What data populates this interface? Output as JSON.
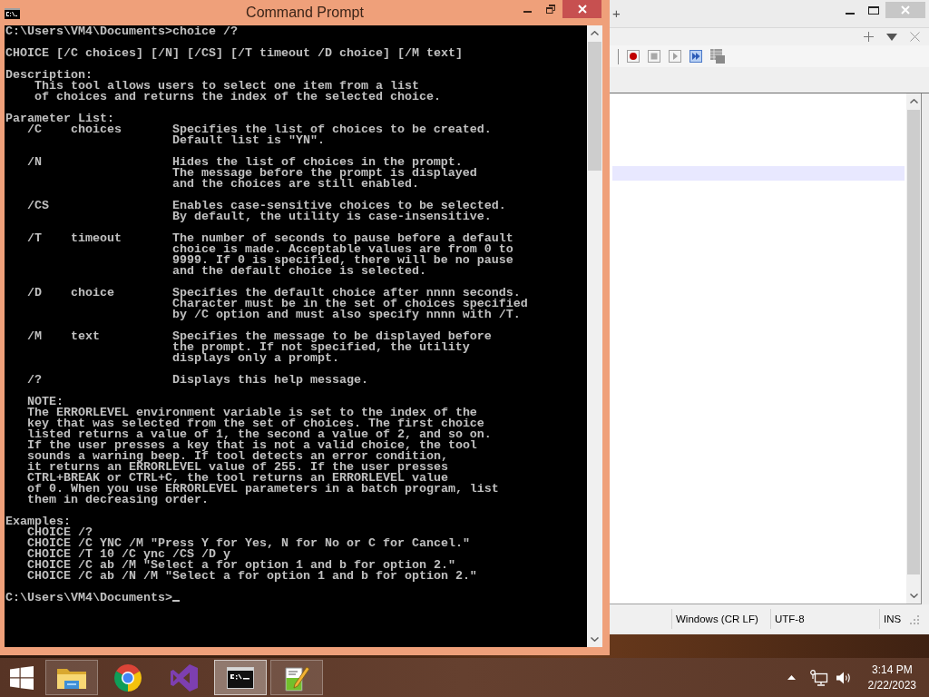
{
  "cmd_window": {
    "title": "Command Prompt",
    "console": {
      "command_line": "C:\\Users\\VM4\\Documents>choice /?",
      "usage": "CHOICE [/C choices] [/N] [/CS] [/T timeout /D choice] [/M text]",
      "description": {
        "heading": "Description:",
        "lines": [
          "This tool allows users to select one item from a list",
          "of choices and returns the index of the selected choice."
        ]
      },
      "parameter_list": {
        "heading": "Parameter List:",
        "parameters": [
          {
            "option": "/C",
            "argument": "choices",
            "lines": [
              "Specifies the list of choices to be created.",
              "Default list is \"YN\"."
            ]
          },
          {
            "option": "/N",
            "lines": [
              "Hides the list of choices in the prompt.",
              "The message before the prompt is displayed",
              "and the choices are still enabled."
            ]
          },
          {
            "option": "/CS",
            "lines": [
              "Enables case-sensitive choices to be selected.",
              "By default, the utility is case-insensitive."
            ]
          },
          {
            "option": "/T",
            "argument": "timeout",
            "lines": [
              "The number of seconds to pause before a default",
              "choice is made. Acceptable values are from 0 to",
              "9999. If 0 is specified, there will be no pause",
              "and the default choice is selected."
            ]
          },
          {
            "option": "/D",
            "argument": "choice",
            "lines": [
              "Specifies the default choice after nnnn seconds.",
              "Character must be in the set of choices specified",
              "by /C option and must also specify nnnn with /T."
            ]
          },
          {
            "option": "/M",
            "argument": "text",
            "lines": [
              "Specifies the message to be displayed before",
              "the prompt. If not specified, the utility",
              "displays only a prompt."
            ]
          },
          {
            "option": "/?",
            "lines": [
              "Displays this help message."
            ]
          }
        ]
      },
      "note": {
        "heading": "NOTE:",
        "lines": [
          "The ERRORLEVEL environment variable is set to the index of the",
          "key that was selected from the set of choices. The first choice",
          "listed returns a value of 1, the second a value of 2, and so on.",
          "If the user presses a key that is not a valid choice, the tool",
          "sounds a warning beep. If tool detects an error condition,",
          "it returns an ERRORLEVEL value of 255. If the user presses",
          "CTRL+BREAK or CTRL+C, the tool returns an ERRORLEVEL value",
          "of 0. When you use ERRORLEVEL parameters in a batch program, list",
          "them in decreasing order."
        ]
      },
      "examples": {
        "heading": "Examples:",
        "lines": [
          "CHOICE /?",
          "CHOICE /C YNC /M \"Press Y for Yes, N for No or C for Cancel.\"",
          "CHOICE /T 10 /C ync /CS /D y",
          "CHOICE /C ab /M \"Select a for option 1 and b for option 2.\"",
          "CHOICE /C ab /N /M \"Select a for option 1 and b for option 2.\""
        ]
      },
      "prompt": "C:\\Users\\VM4\\Documents>"
    }
  },
  "editor_window": {
    "title": "+",
    "status_bar": {
      "line_ending": "Windows (CR LF)",
      "encoding": "UTF-8",
      "insert_mode": "INS"
    }
  },
  "taskbar": {
    "apps": [
      {
        "kind": "folder",
        "running": true,
        "selected": false
      },
      {
        "kind": "browser",
        "running": false,
        "selected": false
      },
      {
        "kind": "ide",
        "running": false,
        "selected": false
      },
      {
        "kind": "terminal",
        "running": true,
        "selected": true
      },
      {
        "kind": "editor",
        "running": true,
        "selected": false
      }
    ],
    "clock": {
      "time": "3:14 PM",
      "date": "2/22/2023"
    }
  }
}
